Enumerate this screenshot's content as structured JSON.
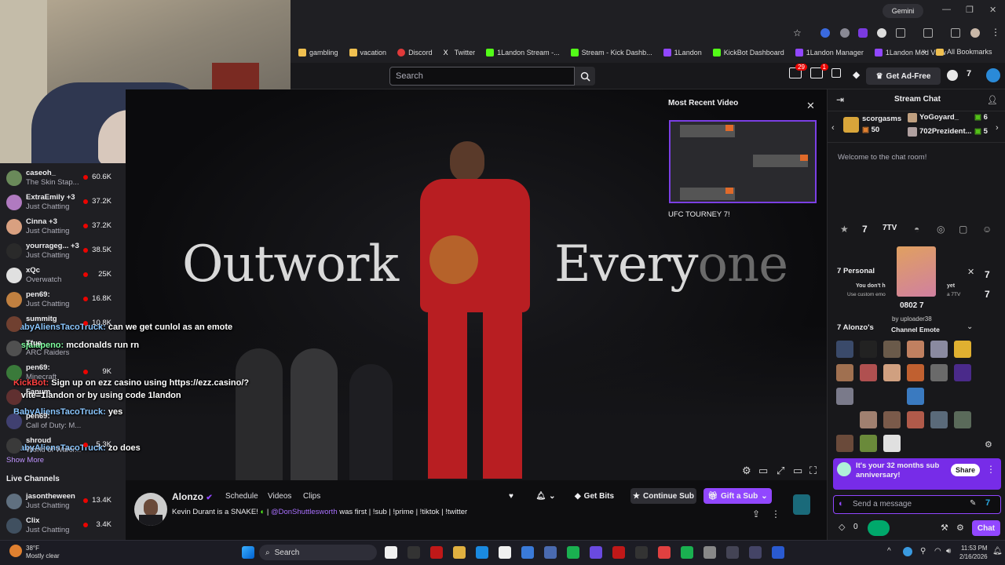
{
  "browser": {
    "gemini_label": "Gemini",
    "bookmarks": [
      {
        "label": "gambling",
        "icon": "folder-icon",
        "color": "#f0c050"
      },
      {
        "label": "vacation",
        "icon": "folder-icon",
        "color": "#f0c050"
      },
      {
        "label": "Discord",
        "icon": "discord-icon",
        "color": "#e03a3a"
      },
      {
        "label": "Twitter",
        "icon": "x-icon",
        "color": "#ffffff"
      },
      {
        "label": "1Landon Stream -...",
        "icon": "kick-icon",
        "color": "#53fc18"
      },
      {
        "label": "Stream - Kick Dashb...",
        "icon": "kick-icon",
        "color": "#53fc18"
      },
      {
        "label": "1Landon",
        "icon": "twitch-icon",
        "color": "#9147ff"
      },
      {
        "label": "KickBot Dashboard",
        "icon": "kick-icon",
        "color": "#53fc18"
      },
      {
        "label": "1Landon Manager",
        "icon": "twitch-icon",
        "color": "#9147ff"
      },
      {
        "label": "1Landon Mod View",
        "icon": "twitch-icon",
        "color": "#9147ff"
      }
    ],
    "all_bookmarks": "All Bookmarks"
  },
  "twitch_nav": {
    "search_placeholder": "Search",
    "notif_count_1": "29",
    "notif_count_2": "1",
    "get_ad_free": "Get Ad-Free"
  },
  "sidebar": {
    "channels": [
      {
        "name": "caseoh_",
        "game": "The Skin Stap...",
        "viewers": "60.6K",
        "color": "#6a8a5a"
      },
      {
        "name": "ExtraEmily +3",
        "game": "Just Chatting",
        "viewers": "37.2K",
        "color": "#b07ac0"
      },
      {
        "name": "Cinna +3",
        "game": "Just Chatting",
        "viewers": "37.2K",
        "color": "#d9a080"
      },
      {
        "name": "yourrageg... +3",
        "game": "Just Chatting",
        "viewers": "38.5K",
        "color": "#2a2a2a"
      },
      {
        "name": "xQc",
        "game": "Overwatch",
        "viewers": "25K",
        "color": "#e0e0e0"
      },
      {
        "name": "pen69:",
        "game": "Just Chatting",
        "viewers": "16.8K",
        "color": "#c08040"
      },
      {
        "name": "summitg",
        "game": "",
        "viewers": "10.8K",
        "color": "#704030"
      },
      {
        "name": "Tfue",
        "game": "ARC Raiders",
        "viewers": "",
        "color": "#505050"
      },
      {
        "name": "pen69:",
        "game": "Minecraft",
        "viewers": "9K",
        "color": "#3a7a3a"
      },
      {
        "name": "Fanum",
        "game": "",
        "viewers": "",
        "color": "#603030"
      },
      {
        "name": "pen69:",
        "game": "Call of Duty: M...",
        "viewers": "",
        "color": "#404070"
      },
      {
        "name": "shroud",
        "game": "World of Warcr...",
        "viewers": "5.3K",
        "color": "#3a3a3a"
      }
    ],
    "show_more": "Show More",
    "live_channels_heading": "Live Channels",
    "live_channels": [
      {
        "name": "jasontheween",
        "game": "Just Chatting",
        "viewers": "13.4K",
        "color": "#607080"
      },
      {
        "name": "Clix",
        "game": "Just Chatting",
        "viewers": "3.4K",
        "color": "#405060"
      }
    ]
  },
  "video": {
    "headline_left": "Outwork",
    "headline_right_bright": "Every",
    "headline_right_dim": "one",
    "recent_title": "Most Recent Video",
    "recent_caption": "UFC TOURNEY 7!"
  },
  "overlay_chat": [
    {
      "user": "BabyAliensTacoTruck:",
      "text": "can we get cunlol as an emote",
      "color": "#8ac6ff"
    },
    {
      "user": "losjalapeno:",
      "text": "mcdonalds run rn",
      "color": "#7fffa0"
    },
    {
      "user": "KickBot:",
      "text": "Sign up on ezz casino using https://ezz.casino/?invite=1landon or by using code 1landon",
      "color": "#ff4040"
    },
    {
      "user": "BabyAliensTacoTruck:",
      "text": "yes",
      "color": "#8ac6ff"
    },
    {
      "user": "BabyAliensTacoTruck:",
      "text": "zo does",
      "color": "#8ac6ff"
    }
  ],
  "channel": {
    "name": "Alonzo",
    "tabs": [
      "Schedule",
      "Videos",
      "Clips"
    ],
    "title_pre": "Kevin Durant is a SNAKE!",
    "mention": "@DonShuttlesworth",
    "title_post": "was first | !sub | !prime | !tiktok | !twitter",
    "get_bits": "Get Bits",
    "continue_sub": "Continue Sub",
    "gift_sub": "Gift a Sub"
  },
  "chat": {
    "title": "Stream Chat",
    "gifters": [
      {
        "name": "scorgasms",
        "count": "50"
      },
      {
        "name": "YoGoyard_",
        "count": "6"
      },
      {
        "name": "702Prezident...",
        "count": "5"
      }
    ],
    "welcome": "Welcome to the chat room!",
    "emote_tab_label": "7TV",
    "personal_label": "Personal",
    "personal_note_1": "You don't h",
    "personal_note_2": "Use custom emo",
    "personal_note_3": "yet",
    "personal_note_4": "a 7TV",
    "alonzo_set": "Alonzo's",
    "tooltip_emote": "0802",
    "tooltip_by": "by uploader38",
    "tooltip_type": "Channel Emote",
    "anniversary": "It's your 32 months sub anniversary!",
    "share": "Share",
    "send_placeholder": "Send a message",
    "points": "0",
    "chat_button": "Chat"
  },
  "taskbar": {
    "temp": "38°F",
    "weather": "Mostly clear",
    "search": "Search",
    "time": "11:53 PM",
    "date": "2/16/2026"
  }
}
